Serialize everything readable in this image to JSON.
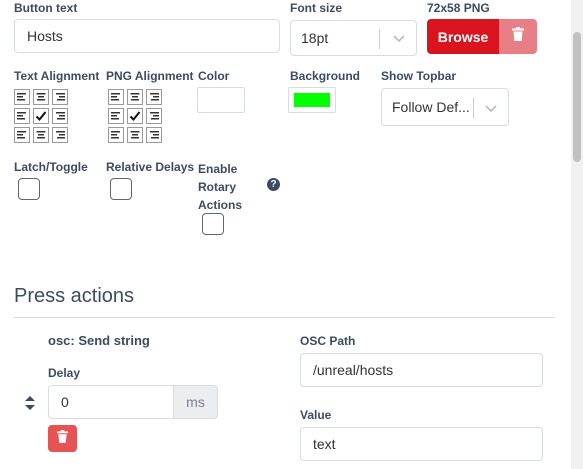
{
  "button_text": {
    "label": "Button text",
    "value": "Hosts"
  },
  "font_size": {
    "label": "Font size",
    "value": "18pt"
  },
  "png": {
    "label": "72x58 PNG",
    "browse_label": "Browse"
  },
  "text_alignment": {
    "label": "Text Alignment"
  },
  "png_alignment": {
    "label": "PNG Alignment"
  },
  "color": {
    "label": "Color",
    "value": "#ffffff"
  },
  "background": {
    "label": "Background",
    "value": "#00ff00"
  },
  "show_topbar": {
    "label": "Show Topbar",
    "value": "Follow Def..."
  },
  "latch_toggle": {
    "label": "Latch/Toggle"
  },
  "relative_delays": {
    "label": "Relative Delays"
  },
  "rotary": {
    "label_line1": "Enable",
    "label_line2": "Rotary",
    "label_line3": "Actions"
  },
  "press_actions": {
    "title": "Press actions",
    "action": {
      "name": "osc: Send string",
      "delay_label": "Delay",
      "delay_value": "0",
      "delay_unit": "ms",
      "osc_path_label": "OSC Path",
      "osc_path_value": "/unreal/hosts",
      "value_label": "Value",
      "value_value": "text"
    }
  },
  "colors": {
    "danger": "#d9141f",
    "danger_light": "#e87f87",
    "heading": "#3c4b64"
  }
}
